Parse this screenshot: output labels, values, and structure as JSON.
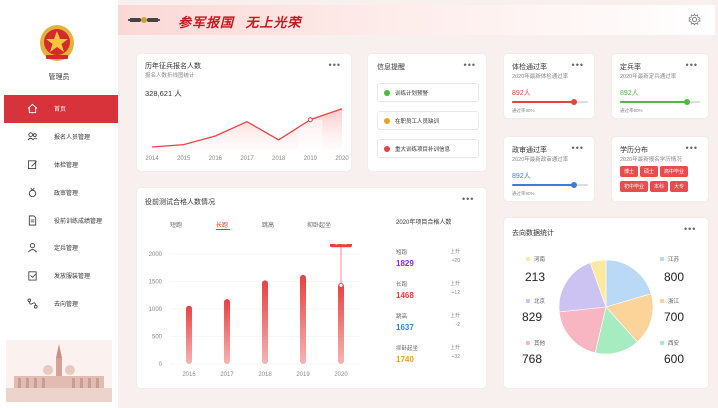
{
  "sidebar": {
    "user": "管理员",
    "items": [
      {
        "label": "首页",
        "icon": "home-icon",
        "active": true
      },
      {
        "label": "报名人员管理",
        "icon": "people-icon"
      },
      {
        "label": "体检管理",
        "icon": "edit-icon"
      },
      {
        "label": "政审管理",
        "icon": "badge-icon"
      },
      {
        "label": "役前训练成绩管理",
        "icon": "document-icon"
      },
      {
        "label": "定兵管理",
        "icon": "user-icon"
      },
      {
        "label": "发放服装管理",
        "icon": "clipboard-icon"
      },
      {
        "label": "去向管理",
        "icon": "route-icon"
      }
    ]
  },
  "header": {
    "slogan": "参军报国   无上光荣"
  },
  "enrollment": {
    "title": "历年征兵报名人数",
    "subtitle": "报名人数折线图统计",
    "total": "328,621 人",
    "years": [
      "2014",
      "2015",
      "2016",
      "2017",
      "2018",
      "2019",
      "2020"
    ]
  },
  "notices": {
    "title": "信息提醒",
    "items": [
      {
        "label": "训练计划预警",
        "color": "#4cbb3a"
      },
      {
        "label": "在职员工人员缺训",
        "color": "#f0a020"
      },
      {
        "label": "重大训练项目补训信息",
        "color": "#e84040"
      }
    ]
  },
  "rates": [
    {
      "title": "体检通过率",
      "subtitle": "2020年最新体检通过率",
      "value": "892人",
      "note": "通过率90%",
      "color": "#e84040",
      "fraction": 0.9
    },
    {
      "title": "定兵率",
      "subtitle": "2020年最新定兵通过率",
      "value": "892人",
      "note": "通过率90%",
      "color": "#4cbb3a",
      "fraction": 0.9
    },
    {
      "title": "政审通过率",
      "subtitle": "2020年最新政审通过率",
      "value": "892人",
      "note": "通过率90%",
      "color": "#3b7dd8",
      "fraction": 0.9
    }
  ],
  "education": {
    "title": "学历分布",
    "subtitle": "2020年最新报名学历情况",
    "tags": [
      "博士",
      "硕士",
      "高中毕业",
      "初中毕业",
      "本科",
      "大专"
    ]
  },
  "training": {
    "title": "役前测试合格人数情况",
    "tabs": [
      "短跑",
      "长跑",
      "跳高",
      "抑卧起坐"
    ],
    "active_tab": 1,
    "panel_title": "2020年项目合格人数",
    "tooltip": "1468",
    "stats": [
      {
        "name": "短跑",
        "value": "1829",
        "dir": "上升",
        "delta": "+20",
        "color": "#8c2be2"
      },
      {
        "name": "长跑",
        "value": "1468",
        "dir": "上升",
        "delta": "+12",
        "color": "#e84040"
      },
      {
        "name": "跳高",
        "value": "1637",
        "dir": "上升",
        "delta": "-2",
        "color": "#3b7dd8"
      },
      {
        "name": "抑卧起坐",
        "value": "1740",
        "dir": "上升",
        "delta": "+32",
        "color": "#f0a020"
      }
    ]
  },
  "destination": {
    "title": "去向数据统计",
    "left": [
      {
        "name": "河南",
        "value": "213",
        "color": "#fde9a0"
      },
      {
        "name": "北京",
        "value": "829",
        "color": "#ccc3f2"
      },
      {
        "name": "其他",
        "value": "768",
        "color": "#f7b6c2"
      }
    ],
    "right": [
      {
        "name": "江苏",
        "value": "800",
        "color": "#b9d9f7"
      },
      {
        "name": "浙江",
        "value": "700",
        "color": "#fcd49a"
      },
      {
        "name": "西安",
        "value": "600",
        "color": "#a6ecc0"
      }
    ]
  },
  "chart_data": [
    {
      "type": "area",
      "title": "历年征兵报名人数",
      "categories": [
        "2014",
        "2015",
        "2016",
        "2017",
        "2018",
        "2019",
        "2020"
      ],
      "values": [
        25,
        30,
        48,
        78,
        40,
        82,
        105
      ],
      "ylim": [
        0,
        140
      ]
    },
    {
      "type": "bar",
      "title": "役前测试合格人数情况",
      "categories": [
        "2016",
        "2017",
        "2018",
        "2019",
        "2020"
      ],
      "values": [
        1060,
        1180,
        1520,
        1620,
        1468
      ],
      "yticks": [
        "0",
        "500",
        "1000",
        "1500",
        "2000"
      ],
      "ylim": [
        0,
        2000
      ]
    },
    {
      "type": "pie",
      "title": "去向数据统计",
      "labels": [
        "江苏",
        "浙江",
        "西安",
        "其他",
        "北京",
        "河南"
      ],
      "values": [
        800,
        700,
        600,
        768,
        829,
        213
      ],
      "colors": [
        "#b9d9f7",
        "#fcd49a",
        "#a6ecc0",
        "#f7b6c2",
        "#ccc3f2",
        "#fde9a0"
      ]
    }
  ]
}
